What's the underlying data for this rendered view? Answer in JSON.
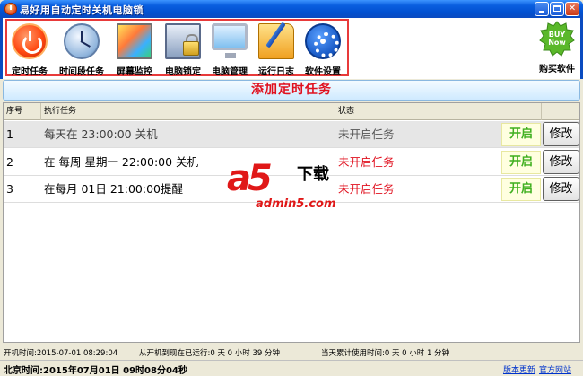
{
  "window": {
    "title": "易好用自动定时关机电脑锁"
  },
  "toolbar": {
    "items": [
      {
        "label": "定时任务",
        "icon": "power-icon"
      },
      {
        "label": "时间段任务",
        "icon": "clock-icon"
      },
      {
        "label": "屏幕监控",
        "icon": "monitor-icon"
      },
      {
        "label": "电脑锁定",
        "icon": "lock-icon"
      },
      {
        "label": "电脑管理",
        "icon": "computer-icon"
      },
      {
        "label": "运行日志",
        "icon": "log-icon"
      },
      {
        "label": "软件设置",
        "icon": "gear-icon"
      }
    ],
    "buy": {
      "label": "购买软件",
      "badge_line1": "BUY",
      "badge_line2": "Now"
    }
  },
  "add_task": {
    "label": "添加定时任务"
  },
  "table": {
    "headers": {
      "num": "序号",
      "task": "执行任务",
      "status": "状态"
    },
    "rows": [
      {
        "num": "1",
        "task": "每天在 23:00:00 关机",
        "status": "未开启任务",
        "toggle": "开启",
        "edit": "修改"
      },
      {
        "num": "2",
        "task": "在 每周 星期一 22:00:00 关机",
        "status": "未开启任务",
        "toggle": "开启",
        "edit": "修改"
      },
      {
        "num": "3",
        "task": "在每月 01日 21:00:00提醒",
        "status": "未开启任务",
        "toggle": "开启",
        "edit": "修改"
      }
    ]
  },
  "watermark": {
    "brand": "a5",
    "download": "下载",
    "site": "admin5.com"
  },
  "status": {
    "boot_time": "开机时间:2015-07-01 08:29:04",
    "uptime": "从开机到现在已运行:0 天 0 小时 39 分钟",
    "today_usage": "当天累计使用时间:0 天 0 小时 1 分钟",
    "clock": "北京时间:2015年07月01日 09时08分04秒",
    "links": {
      "update": "版本更新",
      "site": "官方网站"
    }
  },
  "colors": {
    "accent_red": "#e0101e",
    "toggle_green": "#40b020",
    "title_blue": "#0a5fe0"
  }
}
